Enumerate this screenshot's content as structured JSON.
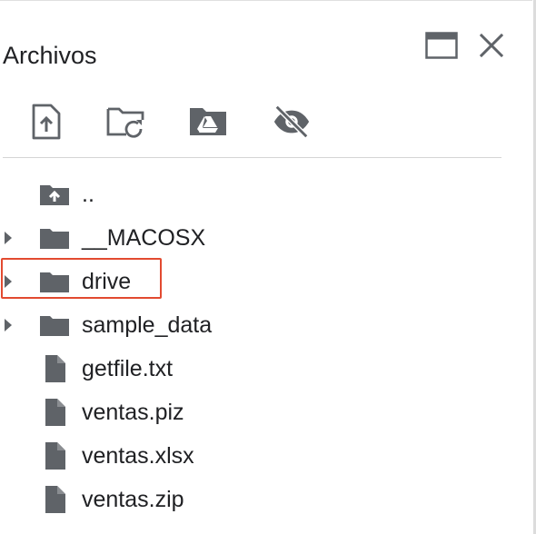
{
  "panel": {
    "title": "Archivos",
    "toolbar": [
      {
        "icon": "upload-file-icon"
      },
      {
        "icon": "refresh-folder-icon"
      },
      {
        "icon": "mount-drive-icon"
      },
      {
        "icon": "hide-files-icon"
      }
    ],
    "tree": [
      {
        "label": "..",
        "type": "parent",
        "expandable": false,
        "icon": "folder-up-icon"
      },
      {
        "label": "__MACOSX",
        "type": "folder",
        "expandable": true,
        "icon": "folder-icon"
      },
      {
        "label": "drive",
        "type": "folder",
        "expandable": true,
        "icon": "folder-icon",
        "highlighted": true
      },
      {
        "label": "sample_data",
        "type": "folder",
        "expandable": true,
        "icon": "folder-icon"
      },
      {
        "label": "getfile.txt",
        "type": "file",
        "expandable": false,
        "icon": "file-icon"
      },
      {
        "label": "ventas.piz",
        "type": "file",
        "expandable": false,
        "icon": "file-icon"
      },
      {
        "label": "ventas.xlsx",
        "type": "file",
        "expandable": false,
        "icon": "file-icon"
      },
      {
        "label": "ventas.zip",
        "type": "file",
        "expandable": false,
        "icon": "file-icon"
      }
    ],
    "colors": {
      "icon": "#5f6368",
      "highlight": "#e24a30",
      "text": "#202124"
    }
  }
}
